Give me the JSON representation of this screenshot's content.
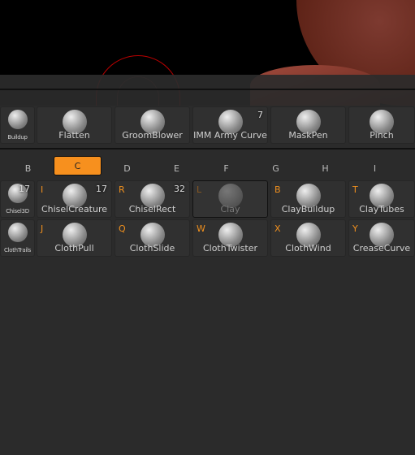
{
  "top_row": [
    {
      "label": "Buildup"
    },
    {
      "label": "Flatten"
    },
    {
      "label": "GroomBlower"
    },
    {
      "label": "IMM Army Curve",
      "count": "7"
    },
    {
      "label": "MaskPen"
    },
    {
      "label": "Pinch"
    }
  ],
  "letters": [
    "B",
    "C",
    "D",
    "E",
    "F",
    "G",
    "H",
    "I"
  ],
  "active_letter": "C",
  "grid_row1": [
    {
      "label": "Chisel3D",
      "key": "",
      "count": "17"
    },
    {
      "label": "ChiselCreature",
      "key": "I",
      "count": "17"
    },
    {
      "label": "ChiselRect",
      "key": "R",
      "count": "32"
    },
    {
      "label": "Clay",
      "key": "L",
      "count": ""
    },
    {
      "label": "ClayBuildup",
      "key": "B",
      "count": ""
    },
    {
      "label": "ClayTubes",
      "key": "T",
      "count": ""
    }
  ],
  "grid_row2": [
    {
      "label": "ClothTrails",
      "key": "",
      "count": ""
    },
    {
      "label": "ClothPull",
      "key": "J",
      "count": ""
    },
    {
      "label": "ClothSlide",
      "key": "Q",
      "count": ""
    },
    {
      "label": "ClothTwister",
      "key": "W",
      "count": ""
    },
    {
      "label": "ClothWind",
      "key": "X",
      "count": ""
    },
    {
      "label": "CreaseCurve",
      "key": "Y",
      "count": ""
    }
  ],
  "colors": {
    "accent": "#f7901e",
    "hotkey": "#f0901e",
    "panel": "#2b2b2b",
    "model": "#6a2a20"
  }
}
